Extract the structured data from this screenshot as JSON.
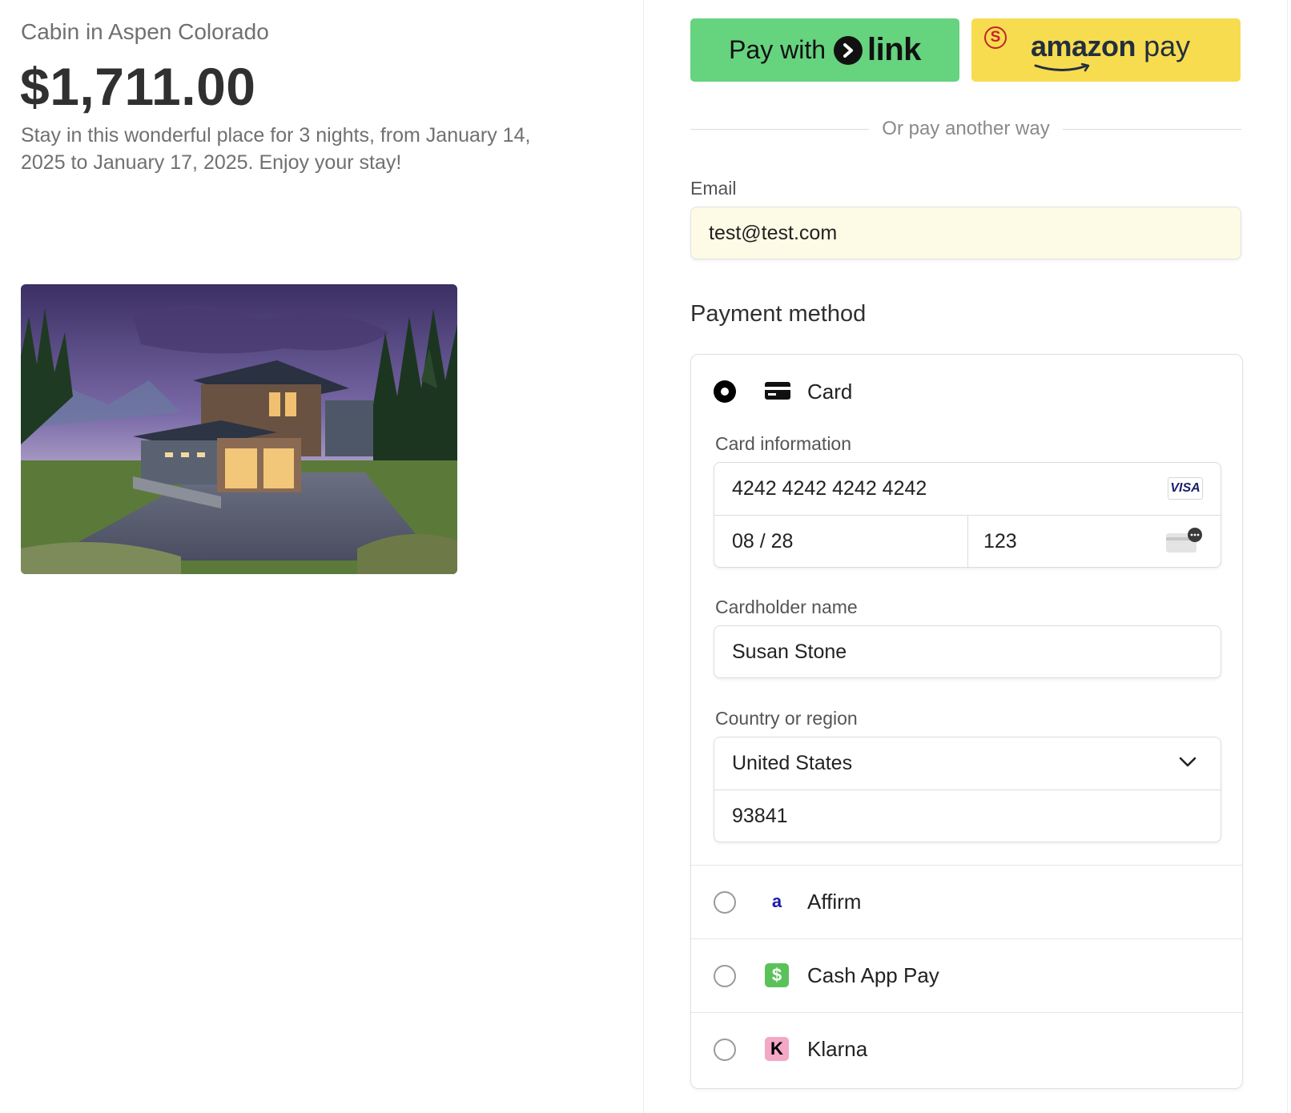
{
  "product": {
    "name": "Cabin in Aspen Colorado",
    "price": "$1,711.00",
    "description": "Stay in this wonderful place for 3 nights, from January 14, 2025 to January 17, 2025. Enjoy your stay!"
  },
  "express": {
    "link_prefix": "Pay with",
    "link_word": "link",
    "amazon_brand": "amazon",
    "amazon_word": "pay",
    "or_text": "Or pay another way"
  },
  "email": {
    "label": "Email",
    "value": "test@test.com"
  },
  "payment": {
    "title": "Payment method",
    "selected": "Card",
    "card": {
      "label": "Card",
      "info_label": "Card information",
      "number": "4242 4242 4242 4242",
      "brand": "VISA",
      "expiry": "08 / 28",
      "cvc": "123",
      "cardholder_label": "Cardholder name",
      "cardholder": "Susan Stone",
      "country_label": "Country or region",
      "country": "United States",
      "zip": "93841"
    },
    "methods": [
      {
        "label": "Affirm",
        "icon": "affirm-icon",
        "glyph": "a"
      },
      {
        "label": "Cash App Pay",
        "icon": "cash-app-icon",
        "glyph": "$"
      },
      {
        "label": "Klarna",
        "icon": "klarna-icon",
        "glyph": "K"
      }
    ]
  },
  "colors": {
    "link_green": "#66d37f",
    "amazon_yellow": "#f7dc50",
    "email_autofill_bg": "#fdfbe6"
  }
}
